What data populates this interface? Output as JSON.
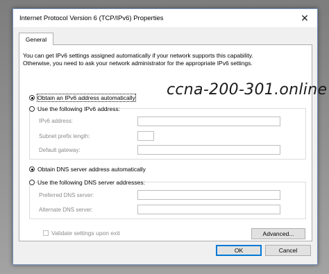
{
  "window": {
    "title": "Internet Protocol Version 6 (TCP/IPv6) Properties",
    "close_glyph": "✕"
  },
  "tabs": [
    {
      "label": "General"
    }
  ],
  "intro": {
    "line1": "You can get IPv6 settings assigned automatically if your network supports this capability.",
    "line2": "Otherwise, you need to ask your network administrator for the appropriate IPv6 settings."
  },
  "watermark": "ccna-200-301.online",
  "ip_section": {
    "auto_label": "Obtain an IPv6 address automatically",
    "auto_selected": true,
    "manual_label": "Use the following IPv6 address:",
    "manual_selected": false,
    "fields": [
      {
        "label": "IPv6 address:",
        "value": ""
      },
      {
        "label": "Subnet prefix length:",
        "value": ""
      },
      {
        "label": "Default gateway:",
        "value": ""
      }
    ]
  },
  "dns_section": {
    "auto_label": "Obtain DNS server address automatically",
    "auto_selected": true,
    "manual_label": "Use the following DNS server addresses:",
    "manual_selected": false,
    "fields": [
      {
        "label": "Preferred DNS server:",
        "value": ""
      },
      {
        "label": "Alternate DNS server:",
        "value": ""
      }
    ]
  },
  "validate": {
    "label": "Validate settings upon exit",
    "checked": false,
    "enabled": false
  },
  "buttons": {
    "advanced": "Advanced...",
    "ok": "OK",
    "cancel": "Cancel"
  }
}
